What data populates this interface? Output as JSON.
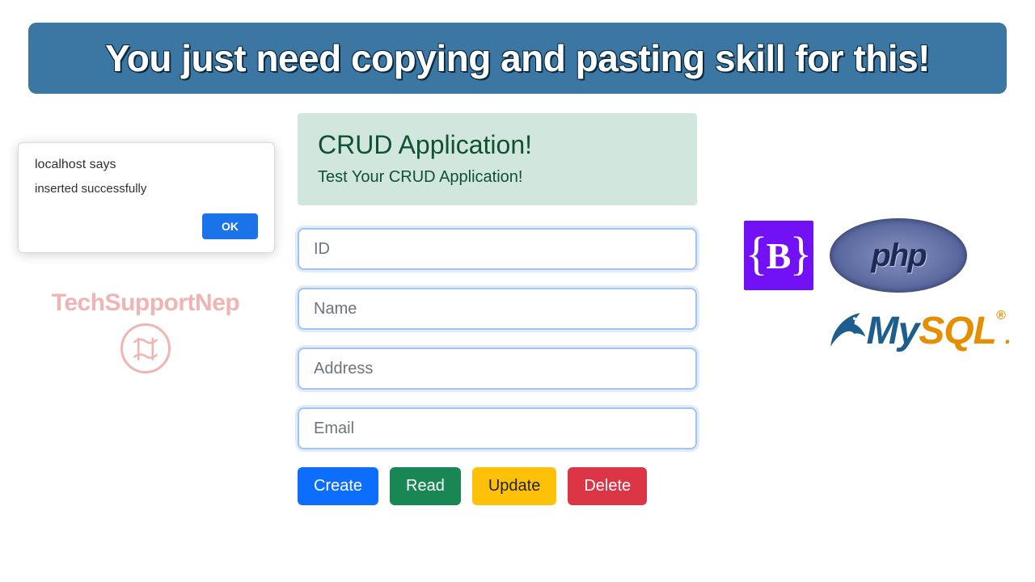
{
  "banner": {
    "text": "You just need copying and pasting skill for this!"
  },
  "alert": {
    "title": "localhost says",
    "message": "inserted successfully",
    "ok": "OK"
  },
  "brand": {
    "name": "TechSupportNep"
  },
  "crud": {
    "title": "CRUD Application!",
    "subtitle": "Test Your CRUD Application!",
    "fields": {
      "id": "ID",
      "name": "Name",
      "address": "Address",
      "email": "Email"
    },
    "buttons": {
      "create": "Create",
      "read": "Read",
      "update": "Update",
      "delete": "Delete"
    }
  },
  "tech": {
    "bootstrap_glyph": "B",
    "php": "php",
    "mysql_my": "My",
    "mysql_sql": "SQL",
    "mysql_reg": "®",
    "mysql_dot": "."
  }
}
